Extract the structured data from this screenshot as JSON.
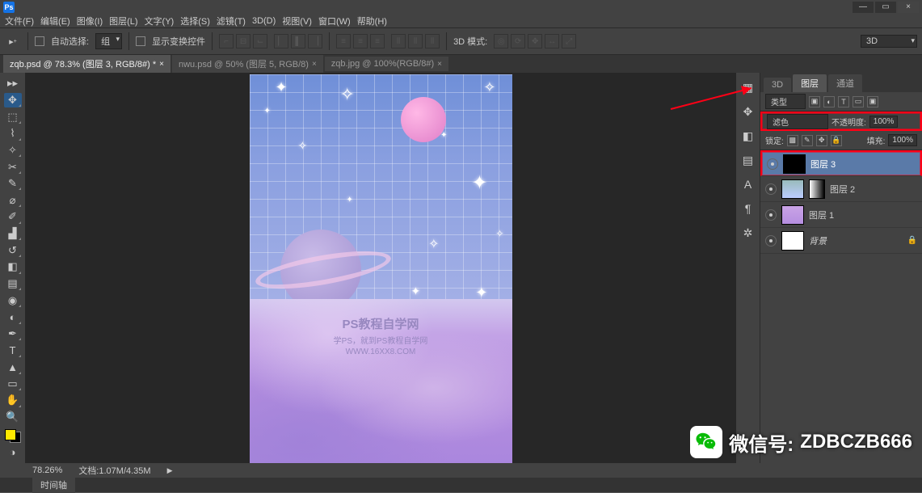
{
  "window_controls": {
    "min": "—",
    "max": "▭",
    "close": "×"
  },
  "menu": [
    "文件(F)",
    "编辑(E)",
    "图像(I)",
    "图层(L)",
    "文字(Y)",
    "选择(S)",
    "滤镜(T)",
    "3D(D)",
    "视图(V)",
    "窗口(W)",
    "帮助(H)"
  ],
  "options": {
    "auto_select": "自动选择:",
    "group": "组",
    "show_transform": "显示变换控件",
    "mode_3d": "3D 模式:",
    "right_3d": "3D"
  },
  "tabs": [
    {
      "label": "zqb.psd @ 78.3% (图层 3, RGB/8#) *",
      "active": true
    },
    {
      "label": "nwu.psd @ 50% (图层 5, RGB/8)",
      "active": false
    },
    {
      "label": "zqb.jpg @ 100%(RGB/8#)",
      "active": false
    }
  ],
  "canvas": {
    "watermark_title": "PS教程自学网",
    "watermark_sub1": "学PS，就到PS教程自学网",
    "watermark_sub2": "WWW.16XX8.COM"
  },
  "panel_tabs": {
    "t3d": "3D",
    "layers": "图层",
    "channels": "通道"
  },
  "filter_row": {
    "kind": "类型"
  },
  "blend_row": {
    "mode": "滤色",
    "opacity_label": "不透明度:",
    "opacity": "100%"
  },
  "lock_row": {
    "lock_label": "锁定:",
    "fill_label": "填充:",
    "fill": "100%"
  },
  "layers": [
    {
      "name": "图层 3",
      "selected": true,
      "thumb": "black",
      "mask": false,
      "locked": false
    },
    {
      "name": "图层 2",
      "selected": false,
      "thumb": "grad",
      "mask": true,
      "locked": false
    },
    {
      "name": "图层 1",
      "selected": false,
      "thumb": "grad2",
      "mask": false,
      "locked": false
    },
    {
      "name": "背景",
      "selected": false,
      "thumb": "white",
      "mask": false,
      "locked": true
    }
  ],
  "status": {
    "zoom": "78.26%",
    "doc": "文档:1.07M/4.35M"
  },
  "timeline": {
    "label": "时间轴"
  },
  "overlay": {
    "label": "微信号:",
    "value": "ZDBCZB666"
  },
  "ps": "Ps"
}
